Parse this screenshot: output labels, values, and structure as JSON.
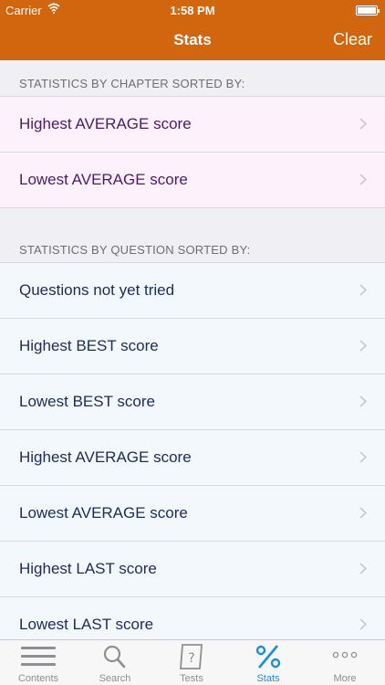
{
  "status": {
    "carrier": "Carrier",
    "time": "1:58 PM"
  },
  "nav": {
    "title": "Stats",
    "clear_label": "Clear"
  },
  "chapter_section": {
    "header": "STATISTICS BY CHAPTER SORTED BY:",
    "items": [
      {
        "label": "Highest AVERAGE score"
      },
      {
        "label": "Lowest AVERAGE score"
      }
    ]
  },
  "question_section": {
    "header": "STATISTICS BY QUESTION SORTED BY:",
    "items": [
      {
        "label": "Questions not yet tried"
      },
      {
        "label": "Highest BEST score"
      },
      {
        "label": "Lowest BEST score"
      },
      {
        "label": "Highest AVERAGE score"
      },
      {
        "label": "Lowest AVERAGE score"
      },
      {
        "label": "Highest LAST score"
      },
      {
        "label": "Lowest LAST score"
      }
    ]
  },
  "tabs": [
    {
      "label": "Contents",
      "icon": "list-icon"
    },
    {
      "label": "Search",
      "icon": "magnifier-icon"
    },
    {
      "label": "Tests",
      "icon": "question-paper-icon"
    },
    {
      "label": "Stats",
      "icon": "percent-icon",
      "active": true
    },
    {
      "label": "More",
      "icon": "more-dots-icon"
    }
  ],
  "colors": {
    "brand": "#d2660f",
    "active_tab": "#1a8fe0",
    "chapter_row_bg": "#fdf2fc",
    "question_row_bg": "#f3f8fd"
  }
}
